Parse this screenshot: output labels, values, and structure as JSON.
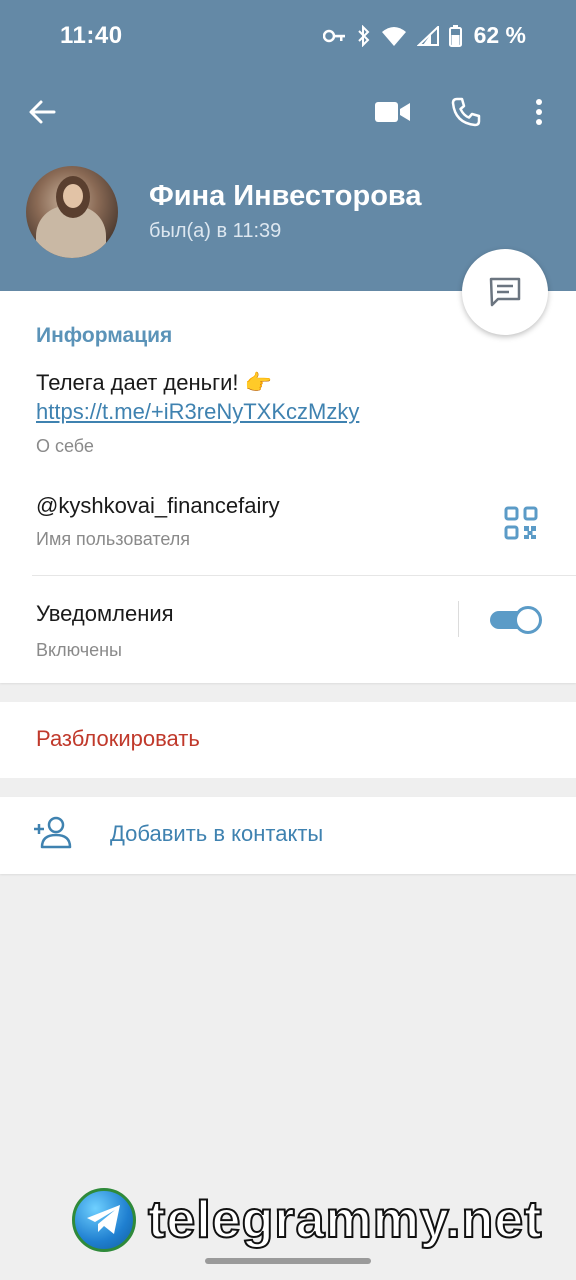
{
  "status_bar": {
    "time": "11:40",
    "battery_percent": "62 %",
    "icons": [
      "key-icon",
      "bluetooth-icon",
      "wifi-icon",
      "signal-icon",
      "battery-icon"
    ]
  },
  "header": {
    "background_color": "#6489a6",
    "buttons": [
      "back-arrow-icon",
      "video-call-icon",
      "phone-icon",
      "more-vertical-icon"
    ],
    "profile": {
      "name": "Фина Инвесторова",
      "last_seen": "был(а) в 11:39"
    },
    "fab_icon": "message-icon"
  },
  "info": {
    "section_title": "Информация",
    "about_text": "Телега дает деньги! 👉",
    "about_link": "https://t.me/+iR3reNyTXKczMzky",
    "about_label": "О себе",
    "username": "@kyshkovai_financefairy",
    "username_label": "Имя пользователя",
    "notifications_title": "Уведомления",
    "notifications_status": "Включены",
    "notifications_enabled": true
  },
  "actions": {
    "unblock_label": "Разблокировать",
    "unblock_color": "#c0392b",
    "add_contact_label": "Добавить в контакты",
    "add_contact_icon": "add-user-icon"
  },
  "watermark": {
    "text": "telegrammy.net"
  }
}
